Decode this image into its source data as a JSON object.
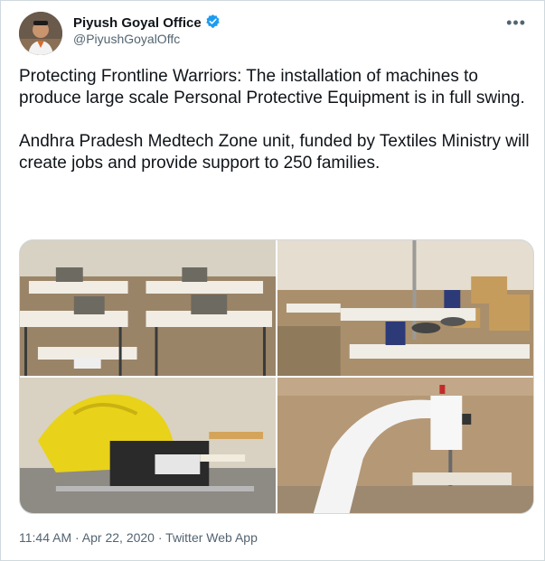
{
  "tweet": {
    "author_name": "Piyush Goyal Office",
    "author_handle": "@PiyushGoyalOffc",
    "more_label": "•••",
    "text": "Protecting Frontline Warriors: The installation of machines to  produce large scale Personal Protective Equipment is in full swing.\n\nAndhra Pradesh Medtech Zone unit, funded by Textiles Ministry will create jobs and provide support to 250 families.",
    "time": "11:44 AM",
    "separator": " · ",
    "date": "Apr 22, 2020",
    "source": "Twitter Web App"
  },
  "colors": {
    "verified": "#1d9bf0",
    "secondary_text": "#536471",
    "border": "#cfd9de"
  },
  "icons": {
    "verified": "verified-badge-icon",
    "more": "more-options-icon"
  }
}
